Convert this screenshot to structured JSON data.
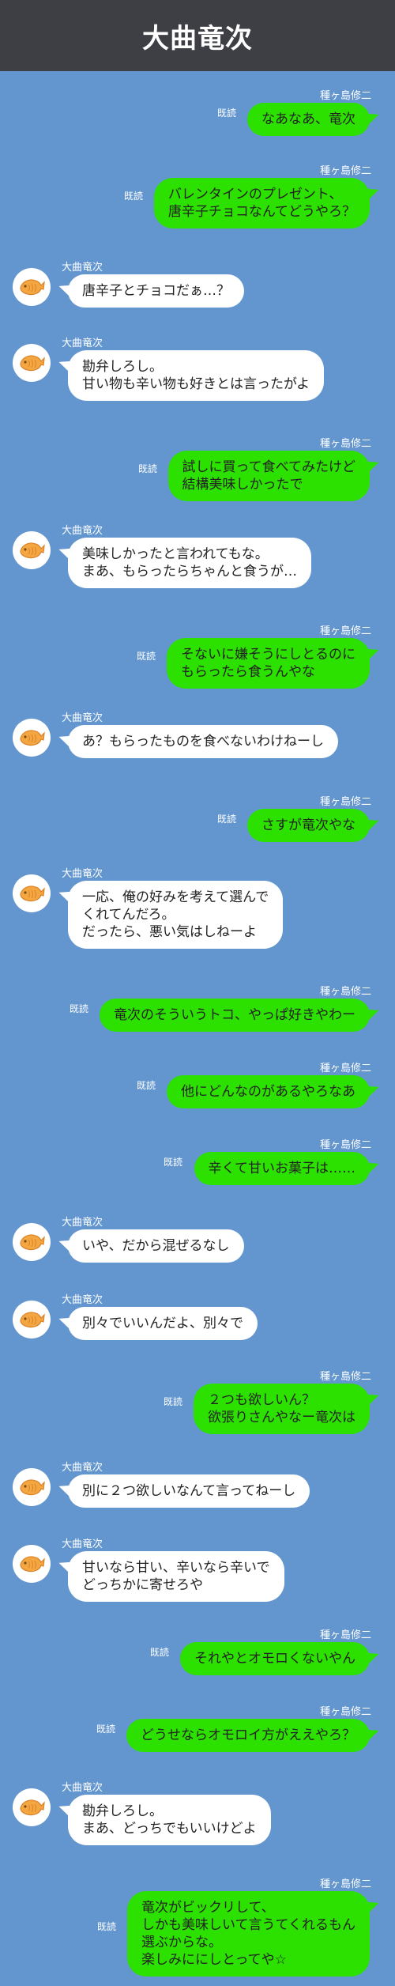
{
  "header": {
    "title": "大曲竜次"
  },
  "read_label": "既読",
  "messages": [
    {
      "side": "right",
      "sender": "種ヶ島修二",
      "lines": [
        "なあなあ、竜次"
      ]
    },
    {
      "side": "right",
      "sender": "種ヶ島修二",
      "lines": [
        "バレンタインのプレゼント、",
        "唐辛子チョコなんてどうやろ？"
      ]
    },
    {
      "side": "left",
      "sender": "大曲竜次",
      "lines": [
        "唐辛子とチョコだぁ…？"
      ]
    },
    {
      "side": "left",
      "sender": "大曲竜次",
      "lines": [
        "勘弁しろし。",
        "甘い物も辛い物も好きとは言ったがよ"
      ]
    },
    {
      "side": "right",
      "sender": "種ヶ島修二",
      "lines": [
        "試しに買って食べてみたけど",
        "結構美味しかったで"
      ]
    },
    {
      "side": "left",
      "sender": "大曲竜次",
      "lines": [
        "美味しかったと言われてもな。",
        "まあ、もらったらちゃんと食うが…"
      ]
    },
    {
      "side": "right",
      "sender": "種ヶ島修二",
      "lines": [
        "そないに嫌そうにしとるのに",
        "もらったら食うんやな"
      ]
    },
    {
      "side": "left",
      "sender": "大曲竜次",
      "lines": [
        "あ？もらったものを食べないわけねーし"
      ]
    },
    {
      "side": "right",
      "sender": "種ヶ島修二",
      "lines": [
        "さすが竜次やな"
      ]
    },
    {
      "side": "left",
      "sender": "大曲竜次",
      "lines": [
        "一応、俺の好みを考えて選んで",
        "くれてんだろ。",
        "だったら、悪い気はしねーよ"
      ]
    },
    {
      "side": "right",
      "sender": "種ヶ島修二",
      "lines": [
        "竜次のそういうトコ、やっぱ好きやわー"
      ]
    },
    {
      "side": "right",
      "sender": "種ヶ島修二",
      "lines": [
        "他にどんなのがあるやろなあ"
      ]
    },
    {
      "side": "right",
      "sender": "種ヶ島修二",
      "lines": [
        "辛くて甘いお菓子は……"
      ]
    },
    {
      "side": "left",
      "sender": "大曲竜次",
      "lines": [
        "いや、だから混ぜるなし"
      ]
    },
    {
      "side": "left",
      "sender": "大曲竜次",
      "lines": [
        "別々でいいんだよ、別々で"
      ]
    },
    {
      "side": "right",
      "sender": "種ヶ島修二",
      "lines": [
        "２つも欲しいん？",
        "欲張りさんやなー竜次は"
      ]
    },
    {
      "side": "left",
      "sender": "大曲竜次",
      "lines": [
        "別に２つ欲しいなんて言ってねーし"
      ]
    },
    {
      "side": "left",
      "sender": "大曲竜次",
      "lines": [
        "甘いなら甘い、辛いなら辛いで",
        "どっちかに寄せろや"
      ]
    },
    {
      "side": "right",
      "sender": "種ヶ島修二",
      "lines": [
        "それやとオモロくないやん"
      ]
    },
    {
      "side": "right",
      "sender": "種ヶ島修二",
      "lines": [
        "どうせならオモロイ方がええやろ？"
      ]
    },
    {
      "side": "left",
      "sender": "大曲竜次",
      "lines": [
        "勘弁しろし。",
        "まあ、どっちでもいいけどよ"
      ]
    },
    {
      "side": "right",
      "sender": "種ヶ島修二",
      "lines": [
        "竜次がビックリして、",
        "しかも美味しいて言うてくれるもん",
        "選ぶからな。",
        "楽しみににしとってや☆"
      ]
    }
  ]
}
